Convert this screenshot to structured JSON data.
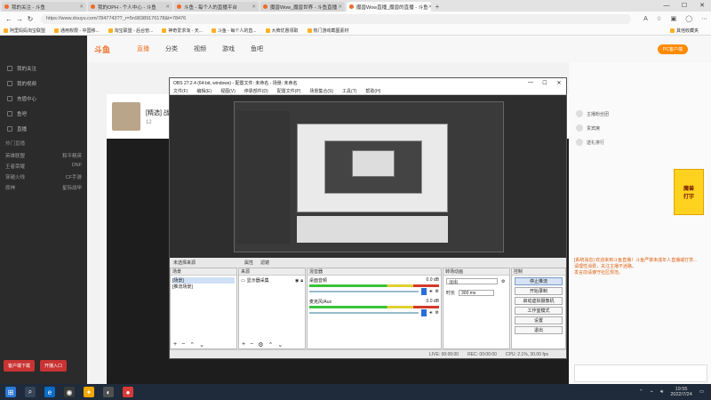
{
  "browser": {
    "tabs": [
      {
        "label": "我的关注 - 斗鱼"
      },
      {
        "label": "我的OPH - 个人中心 - 斗鱼"
      },
      {
        "label": "斗鱼 - 每个人的直播平台"
      },
      {
        "label": "魔兽Wow_魔兽世界 - 斗鱼直播"
      },
      {
        "label": "魔兽Wow直播_魔兽的直播 - 斗鱼"
      }
    ],
    "new_tab": "+",
    "url": "https://www.douyu.com/7847743??_r=5n98389176178&t=78476",
    "bookmarks": [
      "阿里妈妈淘宝联盟",
      "通用权限 - 中国移...",
      "淘宝联盟 - 后台管...",
      "神奇爱求淘 - 天... ",
      "斗鱼 - 每个人的直...",
      "大牌优惠领取",
      "热门游戏截图素材"
    ],
    "bookmarks_right": "其他收藏夹"
  },
  "site": {
    "logo": "斗鱼",
    "nav": [
      "直播",
      "分类",
      "视频",
      "游戏",
      "鱼吧"
    ],
    "pc_button": "PC客户端",
    "sidebar_items": [
      "我的关注",
      "我的视频",
      "充值中心",
      "鱼吧",
      "直播"
    ],
    "sidebar_section": "热门直播",
    "sidebar_rows": [
      [
        "英雄联盟",
        "和平精英"
      ],
      [
        "王者荣耀",
        "DNF"
      ],
      [
        "穿越火线",
        "CF手游"
      ],
      [
        "原神",
        "星际战甲"
      ]
    ],
    "sidebar_buttons": [
      "客户端下载",
      "开播入口"
    ],
    "room_title": "[精选] 战士的视角",
    "follower_count": "12",
    "banner": [
      "魔兽",
      "打字"
    ],
    "chat_lines": [
      "[系统消息] 欢迎来到斗鱼直播！斗鱼严禁未成年人直播或打赏...",
      "请理性消费，关注主播不迷路。",
      "发言前请遵守社区规范。"
    ],
    "right_users": [
      "主播粉丝团",
      "贵宾席",
      "送礼排行"
    ]
  },
  "obs": {
    "title": "OBS 27.2.4 (64-bit, windows) - 配置文件: 未命名 - 场景: 未命名",
    "menu": [
      "文件(F)",
      "编辑(E)",
      "视图(V)",
      "停靠部件(D)",
      "配置文件(P)",
      "场景集合(S)",
      "工具(T)",
      "帮助(H)"
    ],
    "toolbar": {
      "selected": "未选择来源",
      "props": "属性",
      "filters": "滤镜"
    },
    "scenes": {
      "header": "场景",
      "items": [
        "[场景]",
        "[推流场景]"
      ]
    },
    "sources": {
      "header": "来源",
      "items": [
        "显示器采集"
      ]
    },
    "mixer": {
      "header": "混音器",
      "channels": [
        {
          "name": "桌面音频",
          "db": "0.0 dB"
        },
        {
          "name": "麦克风/Aux",
          "db": "0.0 dB"
        }
      ]
    },
    "transitions": {
      "header": "转场动画",
      "type": "淡出",
      "duration_label": "时长",
      "duration": "300 ms"
    },
    "controls": {
      "header": "控制",
      "buttons": [
        "停止推流",
        "开始录制",
        "启动虚拟摄像机",
        "工作室模式",
        "设置",
        "退出"
      ]
    },
    "status": {
      "live": "LIVE: 00:00:00",
      "rec": "REC: 00:00:00",
      "cpu": "CPU: 2.1%, 30.00 fps"
    }
  },
  "taskbar": {
    "time": "19:55",
    "date": "2022/7/24"
  }
}
